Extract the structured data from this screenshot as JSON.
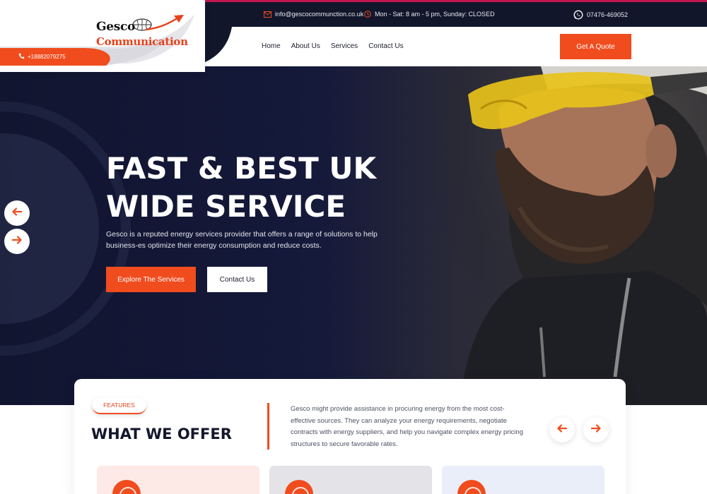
{
  "brand": {
    "name_line1": "Gesco",
    "name_line2": "Communication",
    "phone": "+18882079275"
  },
  "topbar": {
    "email": "info@gescocommunction.co.uk",
    "hours": "Mon - Sat: 8 am - 5 pm, Sunday: CLOSED",
    "whatsapp": "07476-469052"
  },
  "nav": {
    "items": [
      {
        "label": "Home"
      },
      {
        "label": "About Us"
      },
      {
        "label": "Services"
      },
      {
        "label": "Contact Us"
      }
    ],
    "cta": "Get A Quote"
  },
  "hero": {
    "title": "FAST & BEST UK WIDE SERVICE",
    "description": "Gesco is a reputed energy services provider that offers a range of solutions to help business-es optimize their energy consumption and reduce costs.",
    "primary_button": "Explore The Services",
    "secondary_button": "Contact Us"
  },
  "features": {
    "badge": "FEATURES",
    "title": "WHAT WE OFFER",
    "description": "Gesco might provide assistance in procuring energy from the most cost-effective sources. They can analyze your energy requirements, negotiate contracts with energy suppliers, and help you navigate complex energy pricing structures to secure favorable rates.",
    "cards": [
      {
        "bg": "#fde9e6"
      },
      {
        "bg": "#e4e4e8"
      },
      {
        "bg": "#e9eef9"
      }
    ]
  },
  "colors": {
    "accent": "#f04c1e",
    "navy": "#11162b",
    "white": "#ffffff"
  }
}
